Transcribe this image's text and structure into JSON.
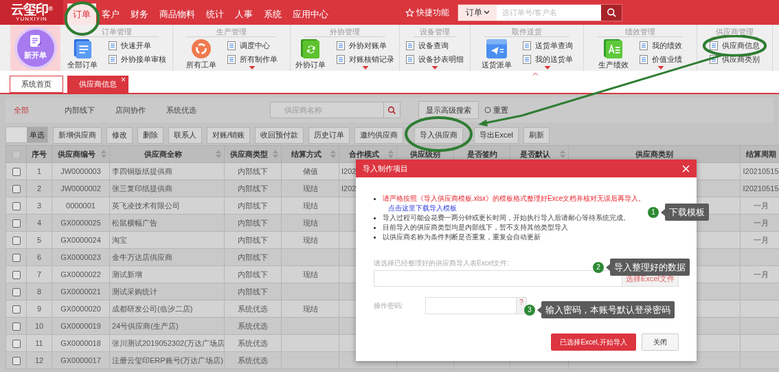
{
  "header": {
    "logo": "云玺印",
    "logo_mark": "®",
    "logo_sub": "YUNXIYIN",
    "menu": [
      {
        "label": "订单",
        "selected": true,
        "highlighted": true
      },
      {
        "label": "客户",
        "selected": false,
        "highlighted": false
      },
      {
        "label": "财务",
        "selected": false,
        "highlighted": false
      },
      {
        "label": "商品物料",
        "selected": false,
        "highlighted": false
      },
      {
        "label": "统计",
        "selected": false,
        "highlighted": false
      },
      {
        "label": "人事",
        "selected": false,
        "highlighted": false
      },
      {
        "label": "系统",
        "selected": false,
        "highlighted": false
      },
      {
        "label": "应用中心",
        "selected": false,
        "highlighted": false
      }
    ],
    "quick": "快捷功能",
    "search": {
      "scope": "订单",
      "placeholder": "选订单号/客户名"
    }
  },
  "ribbon": {
    "new_order": "新开单",
    "groups": [
      {
        "title": "订单管理",
        "big": {
          "label": "全部订单",
          "kind": "document"
        },
        "items": [
          {
            "label": "快速开单",
            "highlighted": false
          },
          {
            "label": "外协接单审核",
            "highlighted": false
          }
        ],
        "more": false
      },
      {
        "title": "生产管理",
        "big": {
          "label": "所有工单",
          "kind": "cycle"
        },
        "items": [
          {
            "label": "调度中心",
            "highlighted": false
          },
          {
            "label": "所有制作单",
            "highlighted": false
          }
        ],
        "more": true
      },
      {
        "title": "外协管理",
        "big": {
          "label": "外协订单",
          "kind": "sync"
        },
        "items": [
          {
            "label": "外协对账单",
            "highlighted": false
          },
          {
            "label": "对账核销记录",
            "highlighted": false
          }
        ],
        "more": true
      },
      {
        "title": "设备管理",
        "items": [
          {
            "label": "设备查询",
            "highlighted": false
          },
          {
            "label": "设备抄表明细",
            "highlighted": false
          }
        ],
        "more": true
      },
      {
        "title": "取件送货",
        "big": {
          "label": "送货派单",
          "kind": "send"
        },
        "items": [
          {
            "label": "送货单查询",
            "highlighted": false
          },
          {
            "label": "我的送货单",
            "highlighted": false
          }
        ],
        "more": true
      },
      {
        "title": "绩效管理",
        "big": {
          "label": "生产绩效",
          "kind": "report"
        },
        "items": [
          {
            "label": "我的绩效",
            "highlighted": false
          },
          {
            "label": "价值业绩",
            "highlighted": false
          }
        ],
        "more": true
      },
      {
        "title": "供应商管理",
        "items": [
          {
            "label": "供应商信息",
            "highlighted": true
          },
          {
            "label": "供应商类别",
            "highlighted": false
          }
        ],
        "more": false
      }
    ]
  },
  "tabs": [
    {
      "label": "系统首页",
      "selected": false
    },
    {
      "label": "供应商信息",
      "selected": true,
      "close": "×"
    }
  ],
  "filters": [
    {
      "label": "全部",
      "selected": true
    },
    {
      "label": "内部线下",
      "selected": false
    },
    {
      "label": "店间协作",
      "selected": false
    },
    {
      "label": "系统优选",
      "selected": false
    }
  ],
  "search": {
    "placeholder": "供应商名称"
  },
  "advanced": "显示高级搜索",
  "reset": "重置",
  "mode_switch": {
    "label": "单选",
    "on": true
  },
  "toolbar": [
    {
      "label": "新增供应商",
      "highlighted": false
    },
    {
      "label": "修改",
      "highlighted": false
    },
    {
      "label": "删除",
      "highlighted": false
    },
    {
      "label": "联系人",
      "highlighted": false
    },
    {
      "label": "对账/销账",
      "highlighted": false
    },
    {
      "label": "收回预付款",
      "highlighted": false
    },
    {
      "label": "历史订单",
      "highlighted": false
    },
    {
      "label": "邀约供应商",
      "highlighted": false
    },
    {
      "label": "导入供应商",
      "highlighted": true
    },
    {
      "label": "导出Excel",
      "highlighted": false
    },
    {
      "label": "刷新",
      "highlighted": false
    }
  ],
  "table": {
    "select_all": false,
    "columns": [
      {
        "label": "序号",
        "sortable": false
      },
      {
        "label": "供应商编号",
        "sortable": true
      },
      {
        "label": "供应商全称",
        "sortable": true
      },
      {
        "label": "供应商类型",
        "sortable": true
      },
      {
        "label": "结算方式",
        "sortable": true
      },
      {
        "label": "合作模式",
        "sortable": true
      },
      {
        "label": "供应级别",
        "sortable": false
      },
      {
        "label": "是否签约",
        "sortable": false
      },
      {
        "label": "是否默认",
        "sortable": true
      },
      {
        "label": "供应商类别",
        "sortable": false
      },
      {
        "label": "结算周期",
        "sortable": false
      }
    ],
    "rows": [
      {
        "checked": false,
        "no": "1",
        "code": "JW0000003",
        "name": "李四铜版纸提供商",
        "type": "内部线下",
        "settle": "储值",
        "mode": "I202",
        "period": "I20210515"
      },
      {
        "checked": false,
        "no": "2",
        "code": "JW0000002",
        "name": "张三复印纸提供商",
        "type": "内部线下",
        "settle": "现结",
        "mode": "I202",
        "period": "I20210515"
      },
      {
        "checked": false,
        "no": "3",
        "code": "0000001",
        "name": "英飞凌技术有限公司",
        "type": "内部线下",
        "settle": "现结",
        "period": "一月"
      },
      {
        "checked": false,
        "no": "4",
        "code": "GX0000025",
        "name": "松鼠横幅广告",
        "type": "内部线下",
        "settle": "现结",
        "period": "一月"
      },
      {
        "checked": false,
        "no": "5",
        "code": "GX0000024",
        "name": "淘宝",
        "type": "内部线下",
        "settle": "现结",
        "period": "一月"
      },
      {
        "checked": false,
        "no": "6",
        "code": "GX0000023",
        "name": "金牛万达店供应商",
        "type": "内部线下"
      },
      {
        "checked": false,
        "no": "7",
        "code": "GX0000022",
        "name": "测试新增",
        "type": "内部线下",
        "settle": "现结",
        "period": "一月"
      },
      {
        "checked": false,
        "no": "8",
        "code": "GX0000021",
        "name": "测试采购统计",
        "type": "内部线下"
      },
      {
        "checked": false,
        "no": "9",
        "code": "GX0000020",
        "name": "成都研发公司(临汐二店)",
        "type": "系统优选",
        "settle": "现结"
      },
      {
        "checked": false,
        "no": "10",
        "code": "GX0000019",
        "name": "24号供应商(生产店)",
        "type": "系统优选"
      },
      {
        "checked": false,
        "no": "11",
        "code": "GX0000018",
        "name": "张川测试2019052302(万达广场店",
        "type": "系统优选"
      },
      {
        "checked": false,
        "no": "12",
        "code": "GX0000017",
        "name": "注册云玺印ERP账号(万达广场店)",
        "type": "系统优选"
      }
    ]
  },
  "dialog": {
    "title": "导入制作项目",
    "notes": [
      {
        "kind": "warning",
        "text": "请严格按照《导入供应商模板.xlsx》的模板格式整理好Exce文档并核对无误后再导入。",
        "link": "点击这里下载导入模板"
      },
      {
        "kind": "info",
        "text": "导入过程可能会花费一两分钟或更长时间，开始执行导入后请耐心等待系统完成。"
      },
      {
        "kind": "info",
        "text": "目前导入的供应商类型均是内部线下，暂不支持其他类型导入"
      },
      {
        "kind": "info",
        "text": "以供应商名称为条件判断是否重复，重复会自动更新"
      }
    ],
    "file_label": "请选择已经整理好的供应商导入表Excel文件:",
    "file_button": "选择Excel文件",
    "password_label": "操作密码:",
    "help": "?",
    "submit": "已选择Excel,开始导入",
    "close": "关闭"
  },
  "callouts": [
    {
      "number": "1",
      "text": "下载模板"
    },
    {
      "number": "2",
      "text": "导入整理好的数据"
    },
    {
      "number": "3",
      "text": "输入密码，本账号默认登录密码"
    }
  ]
}
